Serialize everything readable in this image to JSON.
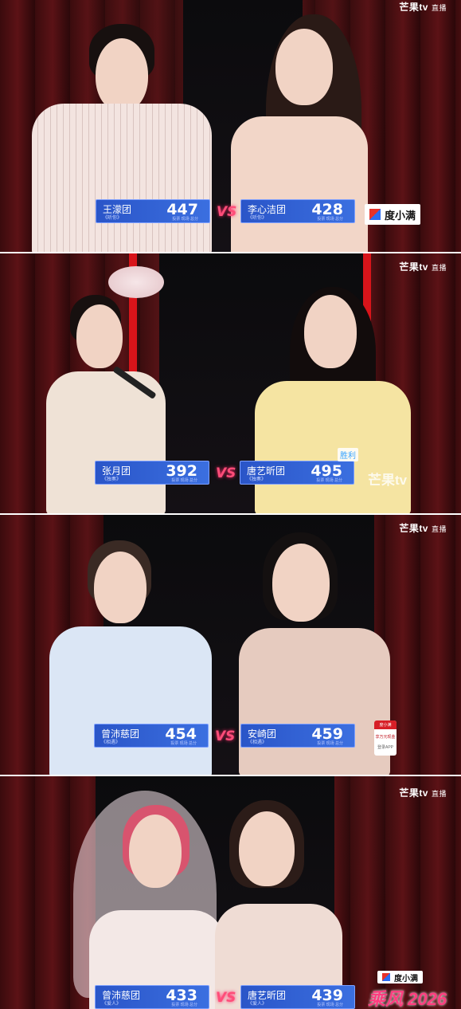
{
  "brand": {
    "logo": "芒果tv",
    "live": "直播"
  },
  "vs_label": "VS",
  "panels": [
    {
      "left": {
        "team": "王濛团",
        "song": "《听你》",
        "score": "447",
        "sub": "投票 现场 总分"
      },
      "right": {
        "team": "李心洁团",
        "song": "《听你》",
        "score": "428",
        "sub": "投票 现场 总分"
      },
      "sponsor": "度小满"
    },
    {
      "left": {
        "team": "张月团",
        "song": "《独奏》",
        "score": "392",
        "sub": "投票 现场 总分"
      },
      "right": {
        "team": "唐艺昕团",
        "song": "《独奏》",
        "score": "495",
        "sub": "投票 现场 总分"
      },
      "watermark": "芒果tv",
      "tag": "胜利"
    },
    {
      "left": {
        "team": "曾沛慈团",
        "song": "《相遇》",
        "score": "454",
        "sub": "投票 现场 总分"
      },
      "right": {
        "team": "安崎团",
        "song": "《相遇》",
        "score": "459",
        "sub": "投票 现场 总分"
      },
      "ad": {
        "top": "度小满",
        "text": "享万元现金",
        "foot": "登录APP"
      }
    },
    {
      "left": {
        "team": "曾沛慈团",
        "song": "《爱人》",
        "score": "433",
        "sub": "投票 现场 总分"
      },
      "right": {
        "team": "唐艺昕团",
        "song": "《爱人》",
        "score": "439",
        "sub": "投票 现场 总分"
      },
      "sponsor": "度小满",
      "show_logo": "乘风 2026"
    }
  ]
}
